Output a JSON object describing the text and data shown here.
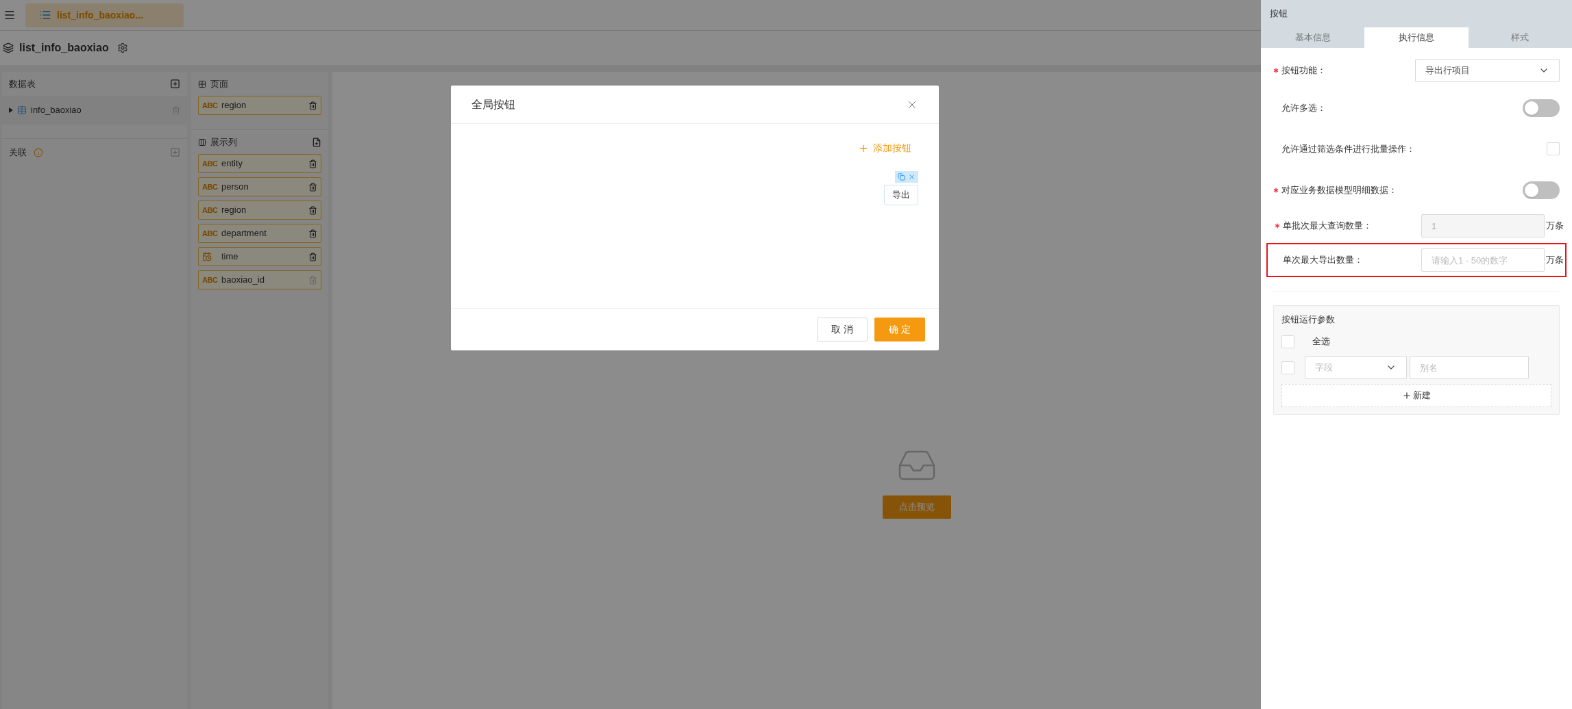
{
  "top_tab": {
    "label": "list_info_baoxiao..."
  },
  "page_title": "list_info_baoxiao",
  "data_tables": {
    "title": "数据表",
    "items": [
      {
        "label": "info_baoxiao",
        "expanded": false
      }
    ]
  },
  "relations": {
    "title": "关联"
  },
  "page_section": {
    "title": "页面",
    "fields": [
      {
        "kind": "text",
        "type_label": "ABC",
        "name": "region",
        "deletable": true
      }
    ]
  },
  "columns_section": {
    "title": "展示列",
    "fields": [
      {
        "kind": "text",
        "type_label": "ABC",
        "name": "entity",
        "deletable": true
      },
      {
        "kind": "text",
        "type_label": "ABC",
        "name": "person",
        "deletable": true
      },
      {
        "kind": "text",
        "type_label": "ABC",
        "name": "region",
        "deletable": true
      },
      {
        "kind": "text",
        "type_label": "ABC",
        "name": "department",
        "deletable": true
      },
      {
        "kind": "date",
        "name": "time",
        "deletable": true
      },
      {
        "kind": "text",
        "type_label": "ABC",
        "name": "baoxiao_id",
        "deletable": false
      }
    ]
  },
  "preview_button": "点击预览",
  "dialog": {
    "title": "全局按钮",
    "add_button": "添加按钮",
    "buttons": [
      {
        "label": "导出",
        "selected": true
      }
    ],
    "cancel": "取 消",
    "confirm": "确 定"
  },
  "properties": {
    "title": "按钮",
    "tabs": [
      {
        "label": "基本信息",
        "selected": false
      },
      {
        "label": "执行信息",
        "selected": true
      },
      {
        "label": "样式",
        "selected": false
      }
    ],
    "rows": [
      {
        "kind": "select",
        "label": "按钮功能：",
        "required": true,
        "value": "导出行项目"
      },
      {
        "kind": "switch",
        "label": "允许多选：",
        "required": false,
        "on": false
      },
      {
        "kind": "checkbox",
        "label": "允许通过筛选条件进行批量操作",
        "colon": "：",
        "required": false,
        "checked": false
      },
      {
        "kind": "switch",
        "label": "对应业务数据模型明细数据：",
        "required": true,
        "on": false
      },
      {
        "kind": "number",
        "label": "单批次最大查询数量：",
        "required": true,
        "value": "1",
        "disabled": true,
        "unit": "万条",
        "highlighted": false
      },
      {
        "kind": "number",
        "label": "单次最大导出数量：",
        "required": false,
        "placeholder": "请输入1 - 50的数字",
        "disabled": false,
        "unit": "万条",
        "highlighted": true
      }
    ]
  },
  "params": {
    "title": "按钮运行参数",
    "select_all": {
      "label": "全选",
      "checked": false
    },
    "rows": [
      {
        "checked": false,
        "field_placeholder": "字段",
        "alias_placeholder": "别名"
      }
    ],
    "new_button": "新建"
  }
}
